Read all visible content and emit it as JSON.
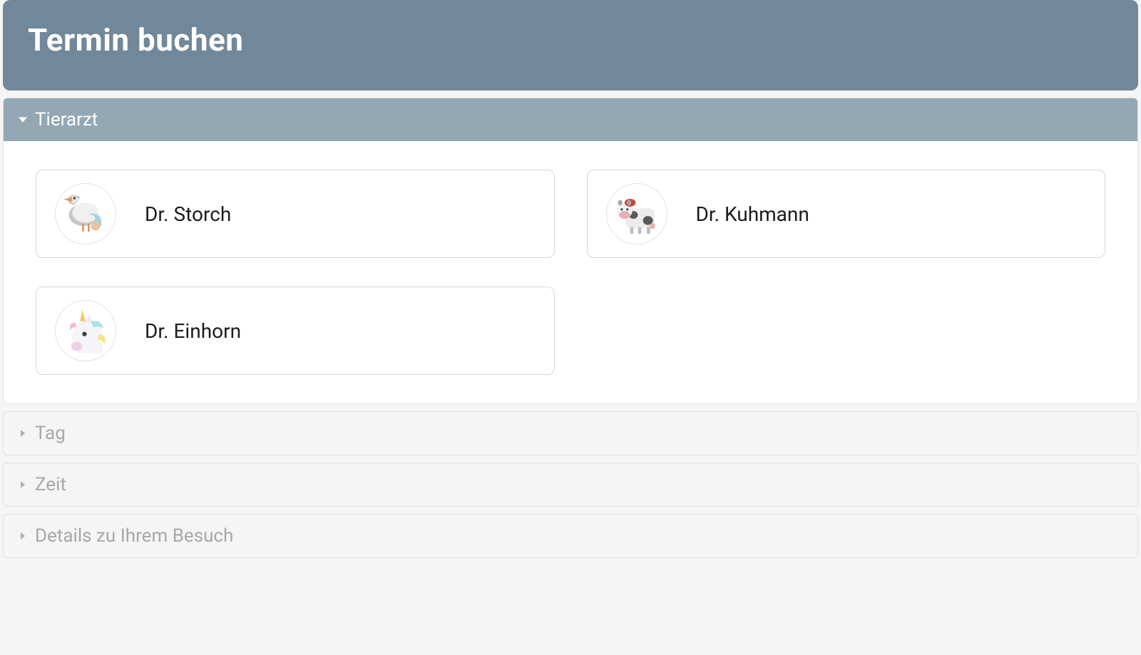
{
  "header": {
    "title": "Termin buchen"
  },
  "sections": {
    "vet": {
      "label": "Tierarzt",
      "expanded": true,
      "items": [
        {
          "name": "Dr. Storch",
          "avatar": "stork"
        },
        {
          "name": "Dr. Kuhmann",
          "avatar": "cow"
        },
        {
          "name": "Dr. Einhorn",
          "avatar": "unicorn"
        }
      ]
    },
    "day": {
      "label": "Tag",
      "expanded": false
    },
    "time": {
      "label": "Zeit",
      "expanded": false
    },
    "details": {
      "label": "Details zu Ihrem Besuch",
      "expanded": false
    }
  }
}
